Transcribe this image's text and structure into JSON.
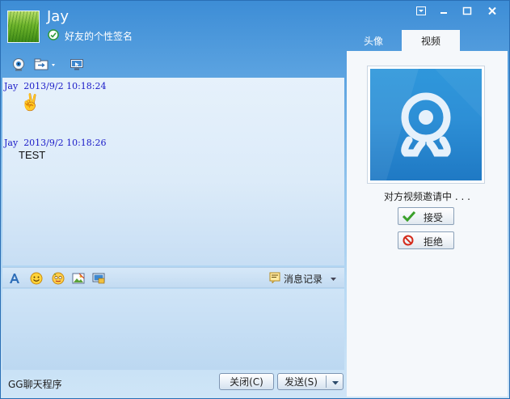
{
  "header": {
    "nickname": "Jay",
    "signature": "好友的个性签名"
  },
  "window_controls": [
    "menu-icon",
    "minimize-icon",
    "maximize-icon",
    "close-icon"
  ],
  "toolbar": {
    "icons": [
      "webcam-icon",
      "file-transfer-icon",
      "remote-desktop-icon"
    ]
  },
  "messages": [
    {
      "sender": "Jay",
      "timestamp": "2013/9/2 10:18:24",
      "content_type": "emoji",
      "emoji": "✌"
    },
    {
      "sender": "Jay",
      "timestamp": "2013/9/2 10:18:26",
      "content_type": "text",
      "text": "TEST"
    }
  ],
  "input_toolbar": {
    "icons": [
      "font-icon",
      "smiley-icon",
      "emoji-face-icon",
      "image-icon",
      "screenshot-icon"
    ],
    "history_label": "消息记录"
  },
  "footer": {
    "app_name": "GG聊天程序",
    "close_label": "关闭(C)",
    "send_label": "发送(S)"
  },
  "right_panel": {
    "tabs": [
      {
        "label": "头像",
        "active": false
      },
      {
        "label": "视频",
        "active": true
      }
    ],
    "status": "对方视频邀请中 . . .",
    "accept_label": "接受",
    "reject_label": "拒绝"
  },
  "colors": {
    "title_gradient_top": "#3d8dd6",
    "timestamp_blue": "#1a1ac8",
    "video_bg": "#2d8fd6",
    "panel_bg": "#f5f8fb"
  }
}
